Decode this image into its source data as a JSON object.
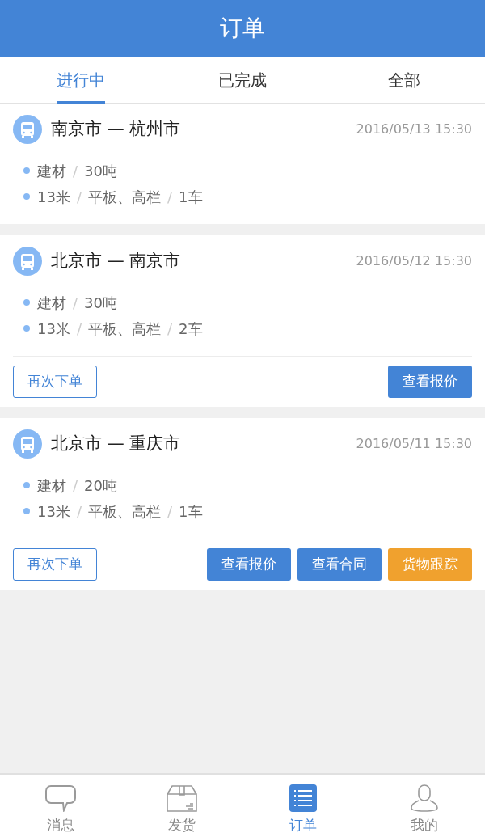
{
  "header": {
    "title": "订单"
  },
  "tabs": [
    {
      "label": "进行中",
      "selected": true
    },
    {
      "label": "已完成",
      "selected": false
    },
    {
      "label": "全部",
      "selected": false
    }
  ],
  "separator": "/",
  "orders": [
    {
      "route": "南京市 — 杭州市",
      "time": "2016/05/13 15:30",
      "lines": [
        [
          "建材",
          "30吨"
        ],
        [
          "13米",
          "平板、高栏",
          "1车"
        ]
      ]
    },
    {
      "route": "北京市 — 南京市",
      "time": "2016/05/12 15:30",
      "lines": [
        [
          "建材",
          "30吨"
        ],
        [
          "13米",
          "平板、高栏",
          "2车"
        ]
      ],
      "actions": [
        {
          "label": "再次下单",
          "kind": "outline"
        },
        {
          "label": "查看报价",
          "kind": "primary"
        }
      ]
    },
    {
      "route": "北京市 — 重庆市",
      "time": "2016/05/11 15:30",
      "lines": [
        [
          "建材",
          "20吨"
        ],
        [
          "13米",
          "平板、高栏",
          "1车"
        ]
      ],
      "actions": [
        {
          "label": "再次下单",
          "kind": "outline"
        },
        {
          "label": "查看报价",
          "kind": "primary"
        },
        {
          "label": "查看合同",
          "kind": "primary"
        },
        {
          "label": "货物跟踪",
          "kind": "warning"
        }
      ]
    }
  ],
  "nav": [
    {
      "label": "消息",
      "kind": "chat",
      "selected": false
    },
    {
      "label": "发货",
      "kind": "box",
      "selected": false
    },
    {
      "label": "订单",
      "kind": "list",
      "selected": true
    },
    {
      "label": "我的",
      "kind": "user",
      "selected": false
    }
  ]
}
